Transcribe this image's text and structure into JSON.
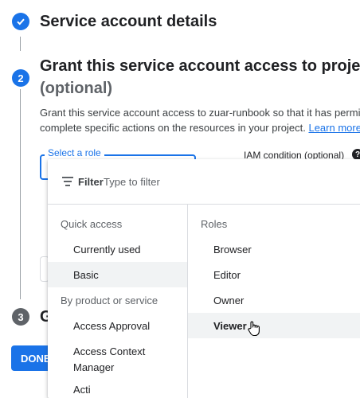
{
  "steps": [
    {
      "number": "✓",
      "title": "Service account details",
      "status": "completed"
    },
    {
      "number": "2",
      "title": "Grant this service account access to project",
      "subtitle": "(optional)",
      "status": "active"
    },
    {
      "number": "3",
      "title": "G",
      "status": "pending"
    }
  ],
  "grant": {
    "description_line1": "Grant this service account access to zuar-runbook so that it has permi",
    "description_line2": "complete specific actions on the resources in your project.",
    "learn_more": "Learn more"
  },
  "role_select": {
    "label": "Select a role"
  },
  "iam_condition": {
    "label": "IAM condition (optional)",
    "help_icon": "?"
  },
  "done_button": {
    "label": "DONE"
  },
  "dropdown": {
    "filter_label": "Filter",
    "filter_placeholder": "Type to filter",
    "left_sections": [
      {
        "title": "Quick access",
        "items": [
          "Currently used",
          "Basic"
        ]
      },
      {
        "title": "By product or service",
        "items": [
          "Access Approval",
          "Access Context",
          "Manager",
          "Acti"
        ]
      }
    ],
    "right_title": "Roles",
    "roles": [
      "Browser",
      "Editor",
      "Owner",
      "Viewer"
    ],
    "selected_left": "Basic",
    "hovered_role": "Viewer"
  },
  "colors": {
    "accent": "#1a73e8",
    "pending_step": "#5f6368",
    "highlight": "#f1f3f4"
  }
}
